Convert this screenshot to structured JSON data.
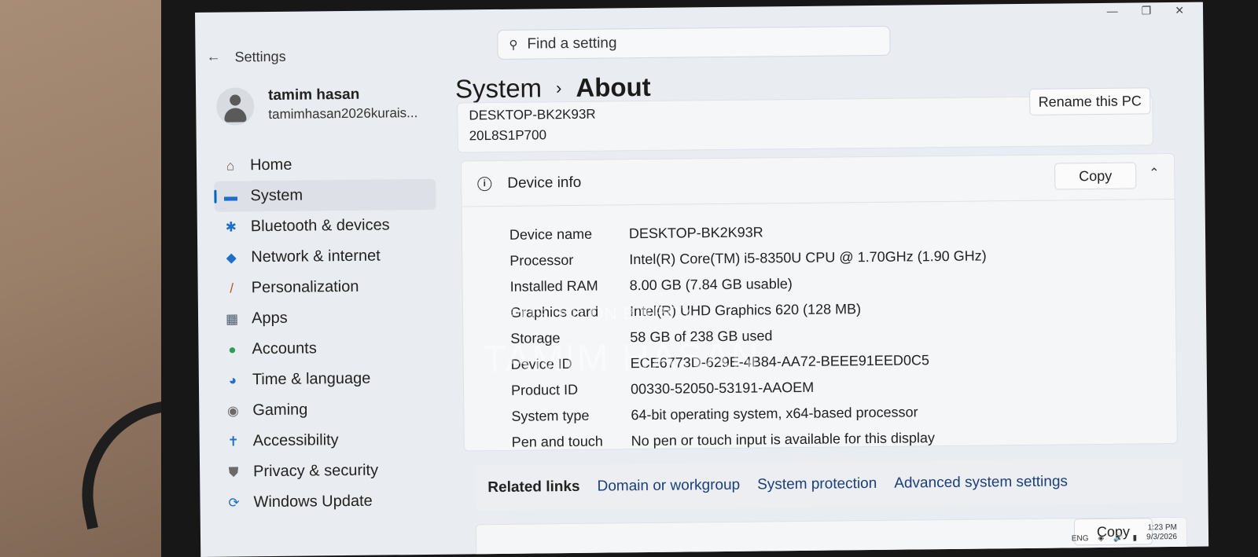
{
  "window": {
    "app_title": "Settings",
    "back": "←",
    "minimize": "—",
    "maximize": "❐",
    "close": "✕"
  },
  "search": {
    "placeholder": "Find a setting"
  },
  "user": {
    "name": "tamim hasan",
    "email": "tamimhasan2026kurais..."
  },
  "sidebar": {
    "items": [
      {
        "label": "Home",
        "icon": "home-icon",
        "glyph": "⌂",
        "color": "#6b4e3a"
      },
      {
        "label": "System",
        "icon": "system-icon",
        "glyph": "▬",
        "color": "#1f6fc8"
      },
      {
        "label": "Bluetooth & devices",
        "icon": "bluetooth-icon",
        "glyph": "✱",
        "color": "#1f6fc8"
      },
      {
        "label": "Network & internet",
        "icon": "wifi-icon",
        "glyph": "◆",
        "color": "#1f6fc8"
      },
      {
        "label": "Personalization",
        "icon": "brush-icon",
        "glyph": "/",
        "color": "#b3541e"
      },
      {
        "label": "Apps",
        "icon": "apps-icon",
        "glyph": "▦",
        "color": "#4a5a6a"
      },
      {
        "label": "Accounts",
        "icon": "person-icon",
        "glyph": "●",
        "color": "#2e9d5b"
      },
      {
        "label": "Time & language",
        "icon": "globe-icon",
        "glyph": "◕",
        "color": "#1f6fc8"
      },
      {
        "label": "Gaming",
        "icon": "gamepad-icon",
        "glyph": "◉",
        "color": "#6a6a6a"
      },
      {
        "label": "Accessibility",
        "icon": "accessibility-icon",
        "glyph": "✝",
        "color": "#1f6fc8"
      },
      {
        "label": "Privacy & security",
        "icon": "shield-icon",
        "glyph": "⛊",
        "color": "#6a6a6a"
      },
      {
        "label": "Windows Update",
        "icon": "update-icon",
        "glyph": "⟳",
        "color": "#1f6fc8"
      }
    ]
  },
  "breadcrumb": {
    "parent": "System",
    "separator": "›",
    "current": "About"
  },
  "pc": {
    "name": "DESKTOP-BK2K93R",
    "model": "20L8S1P700",
    "rename_label": "Rename this PC"
  },
  "device_info": {
    "title": "Device info",
    "copy_label": "Copy",
    "specs": [
      {
        "label": "Device name",
        "value": "DESKTOP-BK2K93R"
      },
      {
        "label": "Processor",
        "value": "Intel(R) Core(TM) i5-8350U CPU @ 1.70GHz (1.90 GHz)"
      },
      {
        "label": "Installed RAM",
        "value": "8.00 GB (7.84 GB usable)"
      },
      {
        "label": "Graphics card",
        "value": "Intel(R) UHD Graphics 620 (128 MB)"
      },
      {
        "label": "Storage",
        "value": "58 GB of 238 GB used"
      },
      {
        "label": "Device ID",
        "value": "ECE6773D-629E-4B84-AA72-BEEE91EED0C5"
      },
      {
        "label": "Product ID",
        "value": "00330-52050-53191-AAOEM"
      },
      {
        "label": "System type",
        "value": "64-bit operating system, x64-based processor"
      },
      {
        "label": "Pen and touch",
        "value": "No pen or touch input is available for this display"
      }
    ]
  },
  "related_links": {
    "label": "Related links",
    "links": [
      "Domain or workgroup",
      "System protection",
      "Advanced system settings"
    ]
  },
  "bottom_card": {
    "copy_label": "Copy"
  },
  "watermark": {
    "line1": "POSTED ON BIKROY",
    "line2": "TAMIM HASAN"
  },
  "tray": {
    "lang": "ENG",
    "time": "1:23 PM",
    "date": "9/3/2026"
  },
  "colors": {
    "accent": "#0067c0",
    "link": "#1a3f7a"
  }
}
